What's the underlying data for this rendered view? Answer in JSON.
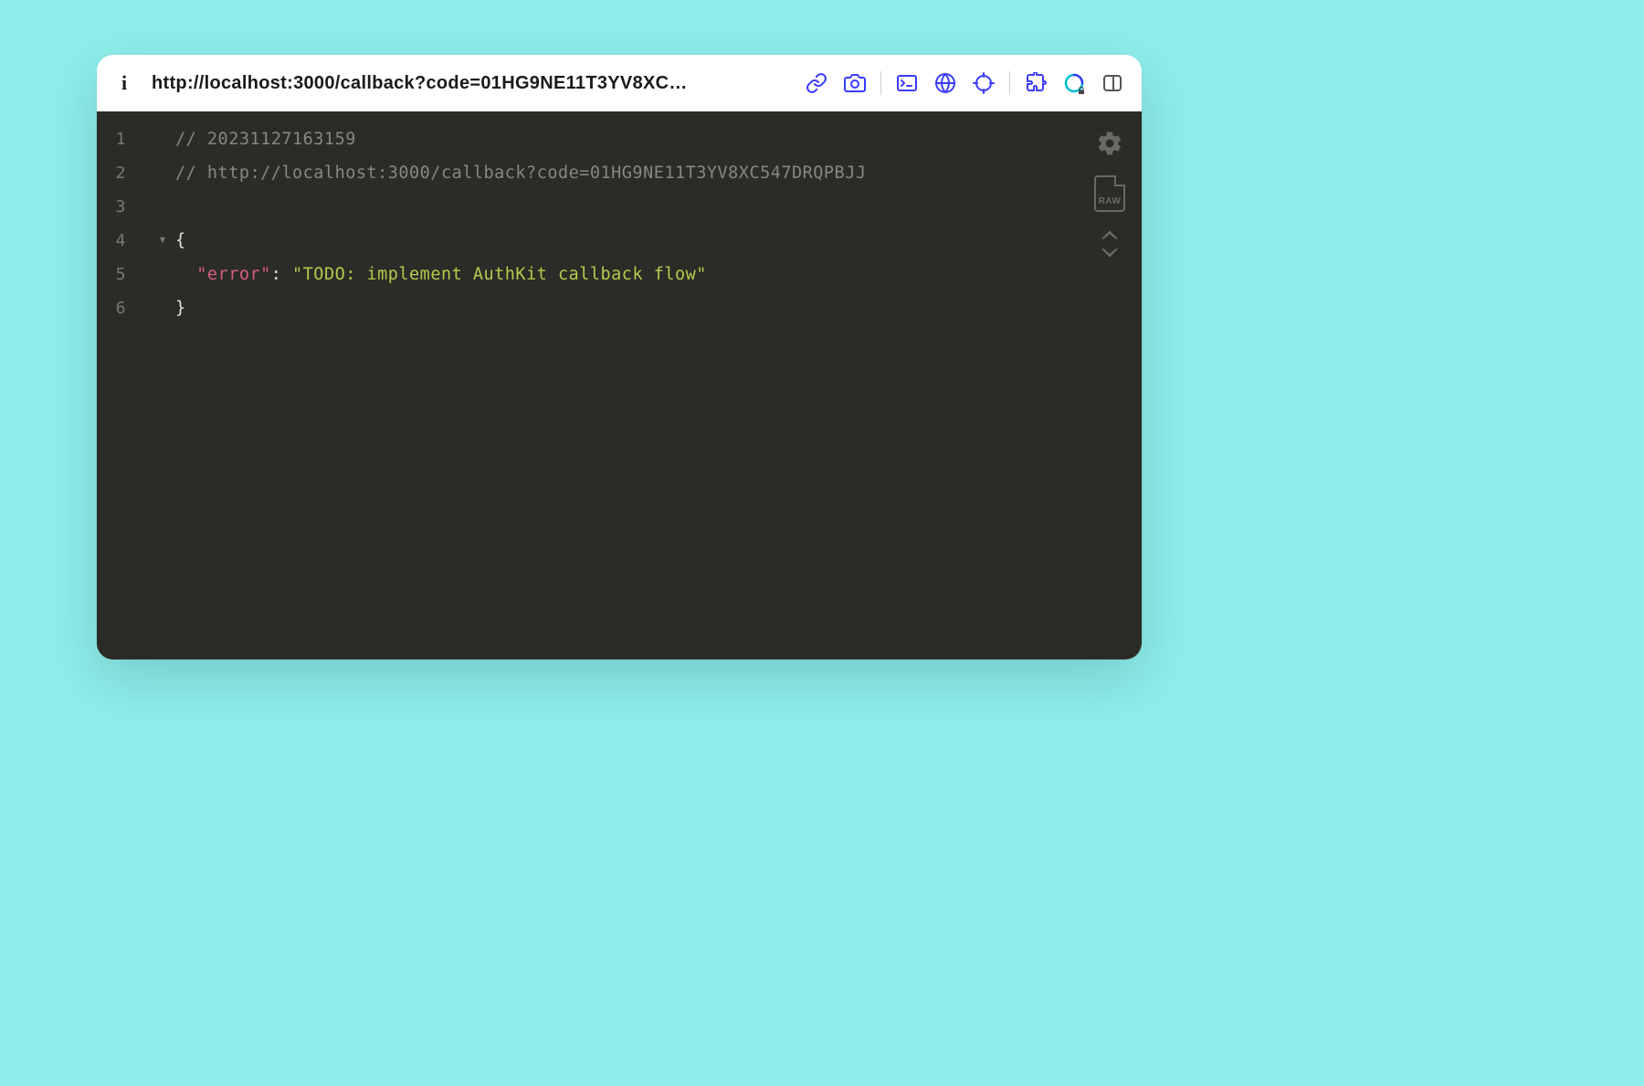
{
  "toolbar": {
    "url_display": "http://localhost:3000/callback?code=01HG9NE11T3YV8XC…",
    "url_full": "http://localhost:3000/callback?code=01HG9NE11T3YV8XC547DRQPBJJ"
  },
  "editor": {
    "line_numbers": [
      "1",
      "2",
      "3",
      "4",
      "5",
      "6"
    ],
    "fold_marker": "▼",
    "raw_label": "RAW",
    "lines": {
      "l1_comment": "// 20231127163159",
      "l2_comment": "// http://localhost:3000/callback?code=01HG9NE11T3YV8XC547DRQPBJJ",
      "l3_blank": "",
      "l4_open": "{",
      "l5_key": "\"error\"",
      "l5_colon": ": ",
      "l5_value": "\"TODO: implement AuthKit callback flow\"",
      "l6_close": "}"
    }
  }
}
